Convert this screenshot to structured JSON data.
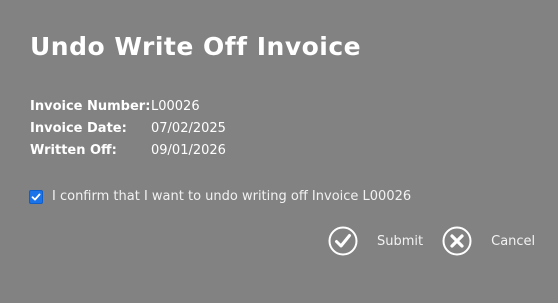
{
  "dialog": {
    "title": "Undo Write Off Invoice",
    "details": [
      {
        "label": "Invoice Number:",
        "value": "L00026"
      },
      {
        "label": "Invoice Date:",
        "value": "07/02/2025"
      },
      {
        "label": "Written Off:",
        "value": "09/01/2026"
      }
    ],
    "confirm": {
      "checked": true,
      "label": "I confirm that I want to undo writing off Invoice L00026"
    },
    "actions": {
      "submit_label": "Submit",
      "cancel_label": "Cancel"
    }
  },
  "colors": {
    "background": "#828282",
    "checkbox_accent": "#1a73e8",
    "text": "#ffffff"
  },
  "icons": {
    "submit": "checkmark-circle-icon",
    "cancel": "close-circle-icon"
  }
}
